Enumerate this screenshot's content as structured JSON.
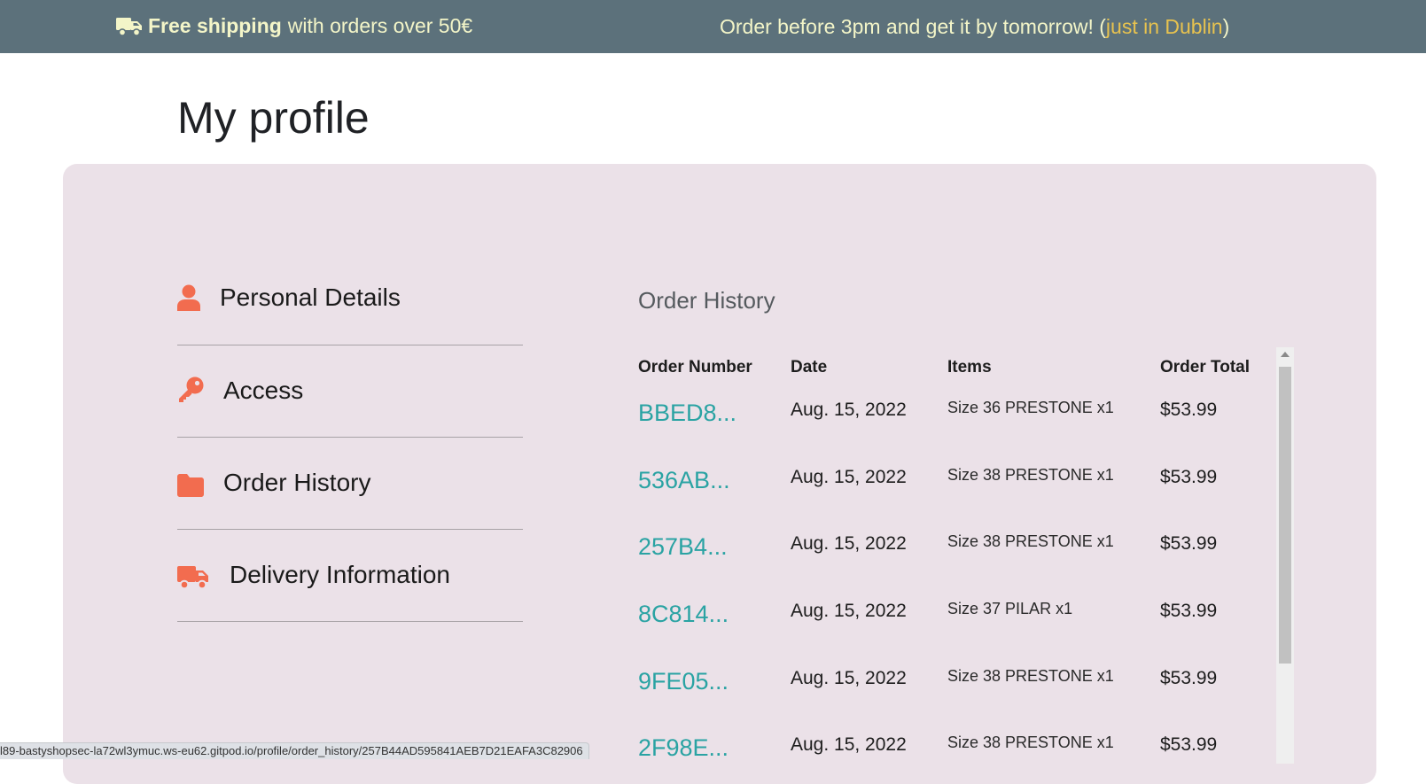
{
  "banner": {
    "free_shipping_bold": "Free shipping",
    "free_shipping_rest": "with orders over 50€",
    "order_msg_prefix": "Order before 3pm and get it by tomorrow! (",
    "order_msg_accent": "just in Dublin",
    "order_msg_suffix": ")"
  },
  "page": {
    "title": "My profile"
  },
  "sidebar": {
    "items": [
      {
        "label": "Personal Details",
        "icon": "user-icon"
      },
      {
        "label": "Access",
        "icon": "key-icon"
      },
      {
        "label": "Order History",
        "icon": "folder-icon"
      },
      {
        "label": "Delivery Information",
        "icon": "truck-icon"
      }
    ]
  },
  "orders": {
    "title": "Order History",
    "columns": {
      "order_number": "Order Number",
      "date": "Date",
      "items": "Items",
      "total": "Order Total"
    },
    "rows": [
      {
        "order_number": "BBED8...",
        "date": "Aug. 15, 2022",
        "items": "Size 36 PRESTONE x1",
        "total": "$53.99"
      },
      {
        "order_number": "536AB...",
        "date": "Aug. 15, 2022",
        "items": "Size 38 PRESTONE x1",
        "total": "$53.99"
      },
      {
        "order_number": "257B4...",
        "date": "Aug. 15, 2022",
        "items": "Size 38 PRESTONE x1",
        "total": "$53.99"
      },
      {
        "order_number": "8C814...",
        "date": "Aug. 15, 2022",
        "items": "Size 37 PILAR x1",
        "total": "$53.99"
      },
      {
        "order_number": "9FE05...",
        "date": "Aug. 15, 2022",
        "items": "Size 38 PRESTONE x1",
        "total": "$53.99"
      },
      {
        "order_number": "2F98E...",
        "date": "Aug. 15, 2022",
        "items": "Size 38 PRESTONE x1",
        "total": "$53.99"
      }
    ]
  },
  "status_bar": {
    "url": "l89-bastyshopsec-la72wl3ymuc.ws-eu62.gitpod.io/profile/order_history/257B44AD595841AEB7D21EAFA3C82906"
  },
  "colors": {
    "banner_bg": "#5c717b",
    "banner_text": "#f3f5c8",
    "banner_accent": "#e7c24f",
    "panel_bg": "#ebe1e8",
    "icon_accent": "#f26c4f",
    "link": "#2aa3a3"
  }
}
